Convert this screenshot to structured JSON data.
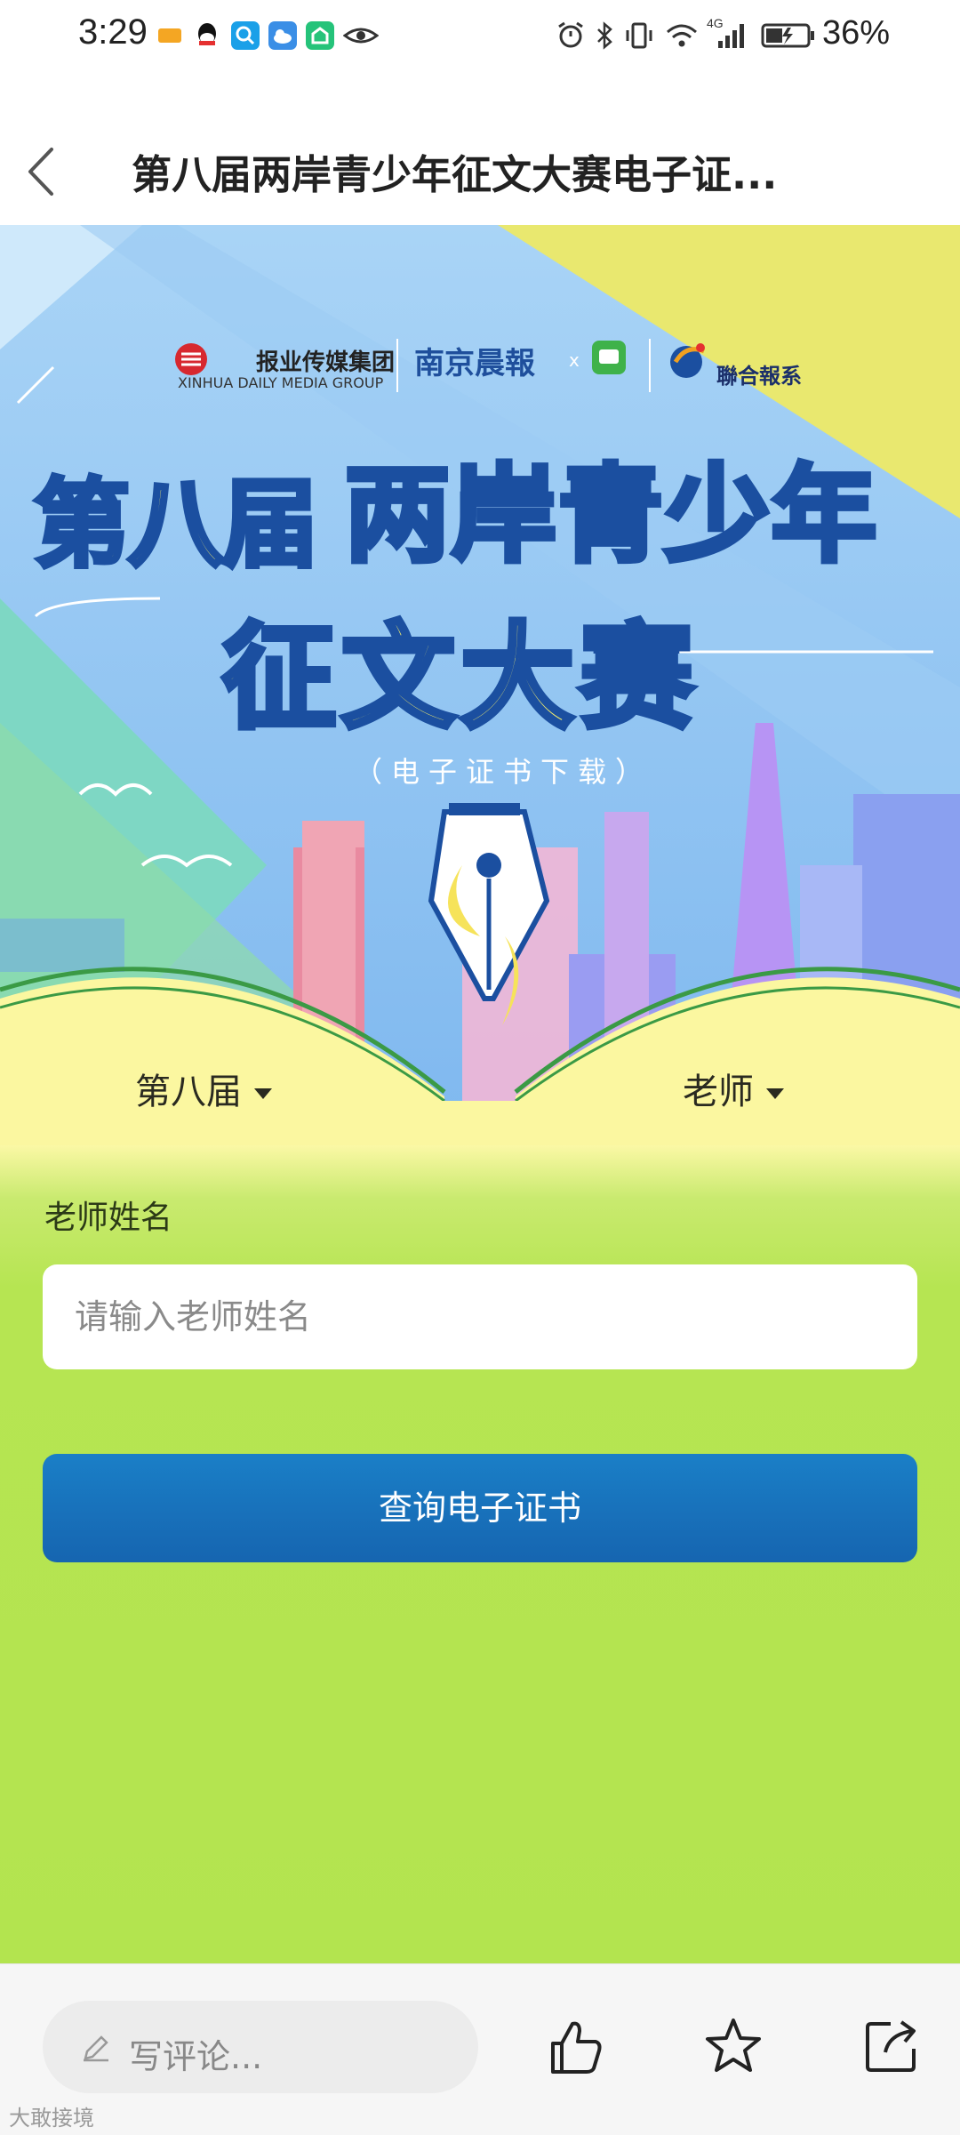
{
  "status_bar": {
    "time": "3:29",
    "battery_percent": "36%",
    "network": "4G"
  },
  "header": {
    "title": "第八届两岸青少年征文大赛电子证..."
  },
  "banner": {
    "logo_xinhua_cn": "报业传媒集团",
    "logo_xinhua_en": "XINHUA DAILY MEDIA GROUP",
    "logo_nanjing": "南京晨報",
    "logo_x": "x",
    "logo_lianhe": "聯合報系",
    "title_line1_a": "第八届",
    "title_line1_b": "两岸青少年",
    "title_line2": "征文大赛",
    "subtitle": "（电子证书下载）"
  },
  "filters": {
    "session": "第八届",
    "role": "老师"
  },
  "form": {
    "name_label": "老师姓名",
    "name_placeholder": "请输入老师姓名",
    "submit_label": "查询电子证书"
  },
  "bottom_bar": {
    "comment_placeholder": "写评论...",
    "watermark": "大敢接境"
  },
  "colors": {
    "submit_button": "#1a73bd",
    "form_background": "#b3e44f",
    "banner_sky": "#8fc6f0",
    "title_yellow": "#f6ef6b"
  }
}
